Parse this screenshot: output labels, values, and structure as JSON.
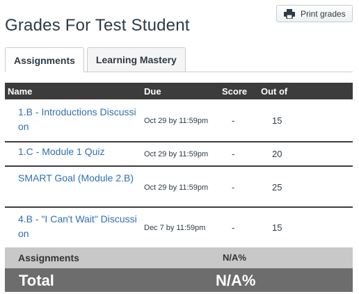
{
  "print_button": {
    "label": "Print grades",
    "icon": "printer-icon"
  },
  "page_title": "Grades For Test Student",
  "tabs": [
    {
      "label": "Assignments",
      "active": true
    },
    {
      "label": "Learning Mastery",
      "active": false
    }
  ],
  "table": {
    "headers": {
      "name": "Name",
      "due": "Due",
      "score": "Score",
      "out_of": "Out of"
    },
    "rows": [
      {
        "name": "1.B - Introductions Discussion",
        "due": "Oct 29 by 11:59pm",
        "score": "-",
        "out_of": "15"
      },
      {
        "name": "1.C - Module 1 Quiz",
        "due": "Oct 29 by 11:59pm",
        "score": "-",
        "out_of": "20"
      },
      {
        "name": "SMART Goal (Module 2.B)",
        "due": "Oct 29 by 11:59pm",
        "score": "-",
        "out_of": "25"
      },
      {
        "name": "4.B - \"I Can't Wait\" Discussion",
        "due": "Dec 7 by 11:59pm",
        "score": "-",
        "out_of": "15"
      }
    ]
  },
  "summary": {
    "group_label": "Assignments",
    "group_value": "N/A%",
    "total_label": "Total",
    "total_value": "N/A%"
  },
  "colors": {
    "link": "#2f6fb4",
    "header_bg": "#3c3c3c",
    "group_bg": "#c8c8c8",
    "total_bg": "#6d6d6d"
  }
}
